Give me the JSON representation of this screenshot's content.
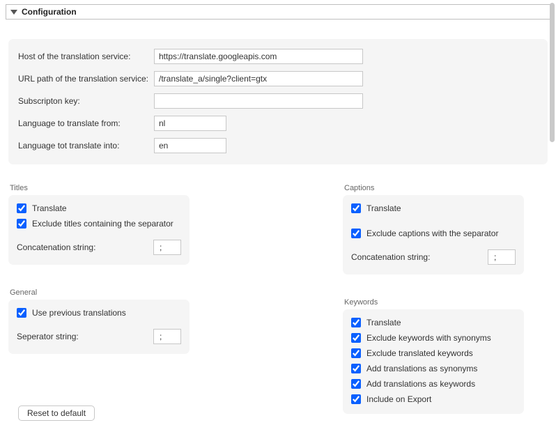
{
  "section_title": "Configuration",
  "config": {
    "host_label": "Host of the translation service:",
    "host_value": "https://translate.googleapis.com",
    "url_label": "URL path of the translation service:",
    "url_value": "/translate_a/single?client=gtx",
    "key_label": "Subscripton key:",
    "key_value": "",
    "from_label": "Language to translate from:",
    "from_value": "nl",
    "to_label": "Language tot translate into:",
    "to_value": "en"
  },
  "titles": {
    "legend": "Titles",
    "translate": "Translate",
    "exclude": "Exclude titles containing the separator",
    "concat_label": "Concatenation string:",
    "concat_value": ";"
  },
  "general": {
    "legend": "General",
    "use_prev": "Use previous translations",
    "sep_label": "Seperator string:",
    "sep_value": ";"
  },
  "captions": {
    "legend": "Captions",
    "translate": "Translate",
    "exclude": "Exclude captions with the separator",
    "concat_label": "Concatenation string:",
    "concat_value": ";"
  },
  "keywords": {
    "legend": "Keywords",
    "translate": "Translate",
    "excl_syn": "Exclude keywords with synonyms",
    "excl_trans": "Exclude translated keywords",
    "add_syn": "Add translations as synonyms",
    "add_kw": "Add translations as keywords",
    "include_export": "Include on Export"
  },
  "reset_label": "Reset to default"
}
